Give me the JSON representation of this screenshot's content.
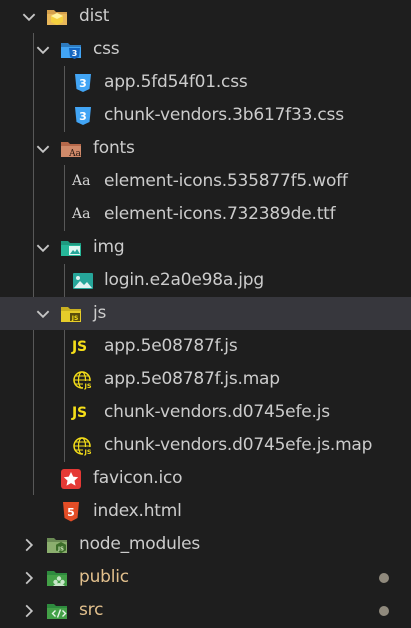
{
  "tree": {
    "items": [
      {
        "label": "dist",
        "type": "folder",
        "expanded": true,
        "icon": "folder-dist-icon"
      },
      {
        "label": "css",
        "type": "folder",
        "expanded": true,
        "icon": "folder-css-icon"
      },
      {
        "label": "app.5fd54f01.css",
        "type": "file",
        "icon": "css3-icon"
      },
      {
        "label": "chunk-vendors.3b617f33.css",
        "type": "file",
        "icon": "css3-icon"
      },
      {
        "label": "fonts",
        "type": "folder",
        "expanded": true,
        "icon": "folder-fonts-icon"
      },
      {
        "label": "element-icons.535877f5.woff",
        "type": "file",
        "icon": "font-icon",
        "glyph": "Aa"
      },
      {
        "label": "element-icons.732389de.ttf",
        "type": "file",
        "icon": "font-icon",
        "glyph": "Aa"
      },
      {
        "label": "img",
        "type": "folder",
        "expanded": true,
        "icon": "folder-images-icon"
      },
      {
        "label": "login.e2a0e98a.jpg",
        "type": "file",
        "icon": "image-icon"
      },
      {
        "label": "js",
        "type": "folder",
        "expanded": true,
        "selected": true,
        "icon": "folder-js-icon"
      },
      {
        "label": "app.5e08787f.js",
        "type": "file",
        "icon": "javascript-icon",
        "glyph": "JS"
      },
      {
        "label": "app.5e08787f.js.map",
        "type": "file",
        "icon": "javascript-map-icon"
      },
      {
        "label": "chunk-vendors.d0745efe.js",
        "type": "file",
        "icon": "javascript-icon",
        "glyph": "JS"
      },
      {
        "label": "chunk-vendors.d0745efe.js.map",
        "type": "file",
        "icon": "javascript-map-icon"
      },
      {
        "label": "favicon.ico",
        "type": "file",
        "icon": "favicon-star-icon"
      },
      {
        "label": "index.html",
        "type": "file",
        "icon": "html5-icon"
      },
      {
        "label": "node_modules",
        "type": "folder",
        "expanded": false,
        "icon": "folder-node-icon"
      },
      {
        "label": "public",
        "type": "folder",
        "expanded": false,
        "modified": true,
        "icon": "folder-public-icon"
      },
      {
        "label": "src",
        "type": "folder",
        "expanded": false,
        "modified": true,
        "icon": "folder-src-icon"
      }
    ]
  },
  "colors": {
    "background": "#1e1e1e",
    "text": "#cccccc",
    "modified_text": "#e2c08d",
    "selected_row": "#37373d",
    "css_icon": "#42a5f5",
    "js_icon": "#f5de19",
    "html_icon": "#e44d26",
    "favicon_icon": "#e53935",
    "modified_dot": "#908a7d"
  }
}
